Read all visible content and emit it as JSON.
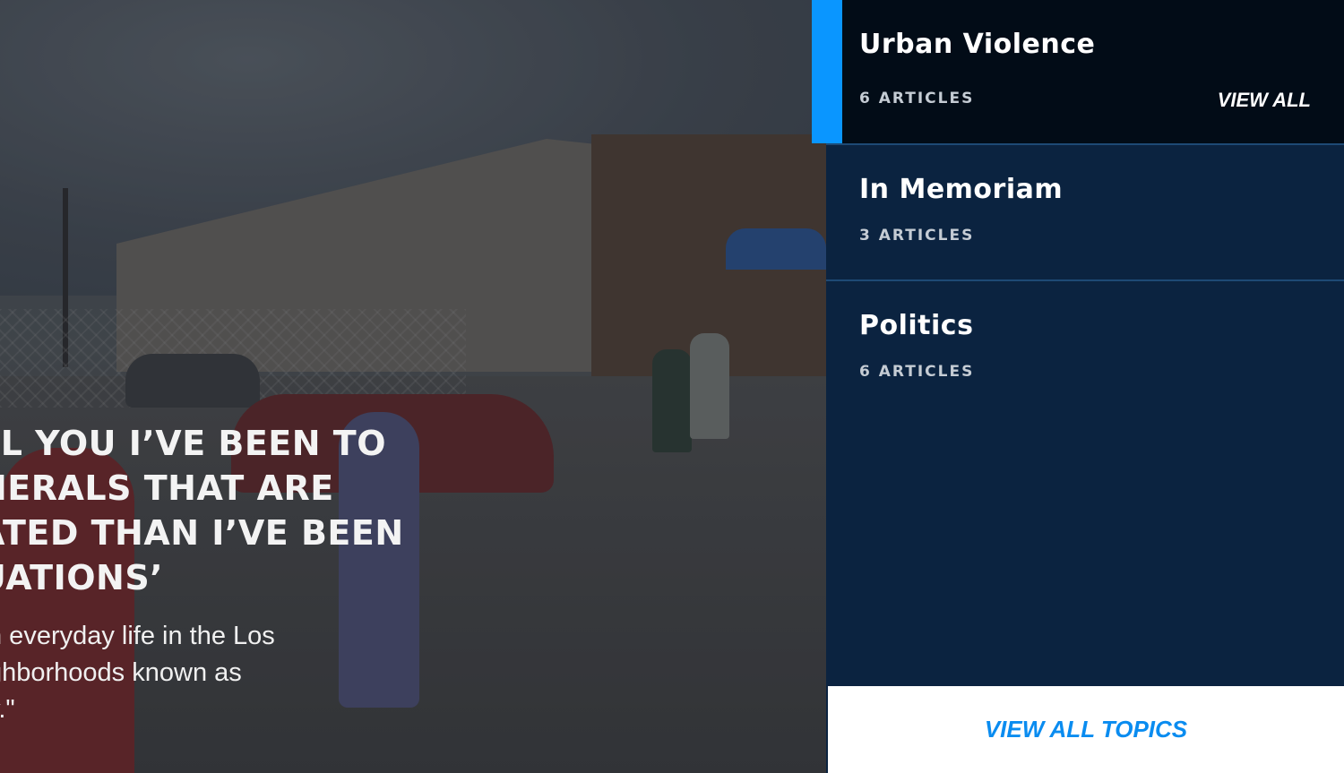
{
  "hero": {
    "quote_lines": [
      "LL YOU I’VE BEEN TO",
      "NERALS THAT ARE",
      "ATED THAN I’VE BEEN",
      "UATIONS’"
    ],
    "description_lines": [
      "n everyday life in the Los",
      "ghborhoods known as",
      "y.\""
    ]
  },
  "topics": {
    "items": [
      {
        "name": "Urban Violence",
        "count": "6 ARTICLES",
        "action": "VIEW ALL"
      },
      {
        "name": "In Memoriam",
        "count": "3 ARTICLES"
      },
      {
        "name": "Politics",
        "count": "6 ARTICLES"
      }
    ],
    "view_all_topics": "VIEW ALL TOPICS"
  },
  "colors": {
    "accent": "#0a96ff",
    "panel_bg": "#0b2340",
    "active_bg": "#020c17",
    "link_blue": "#0a8cf0"
  }
}
